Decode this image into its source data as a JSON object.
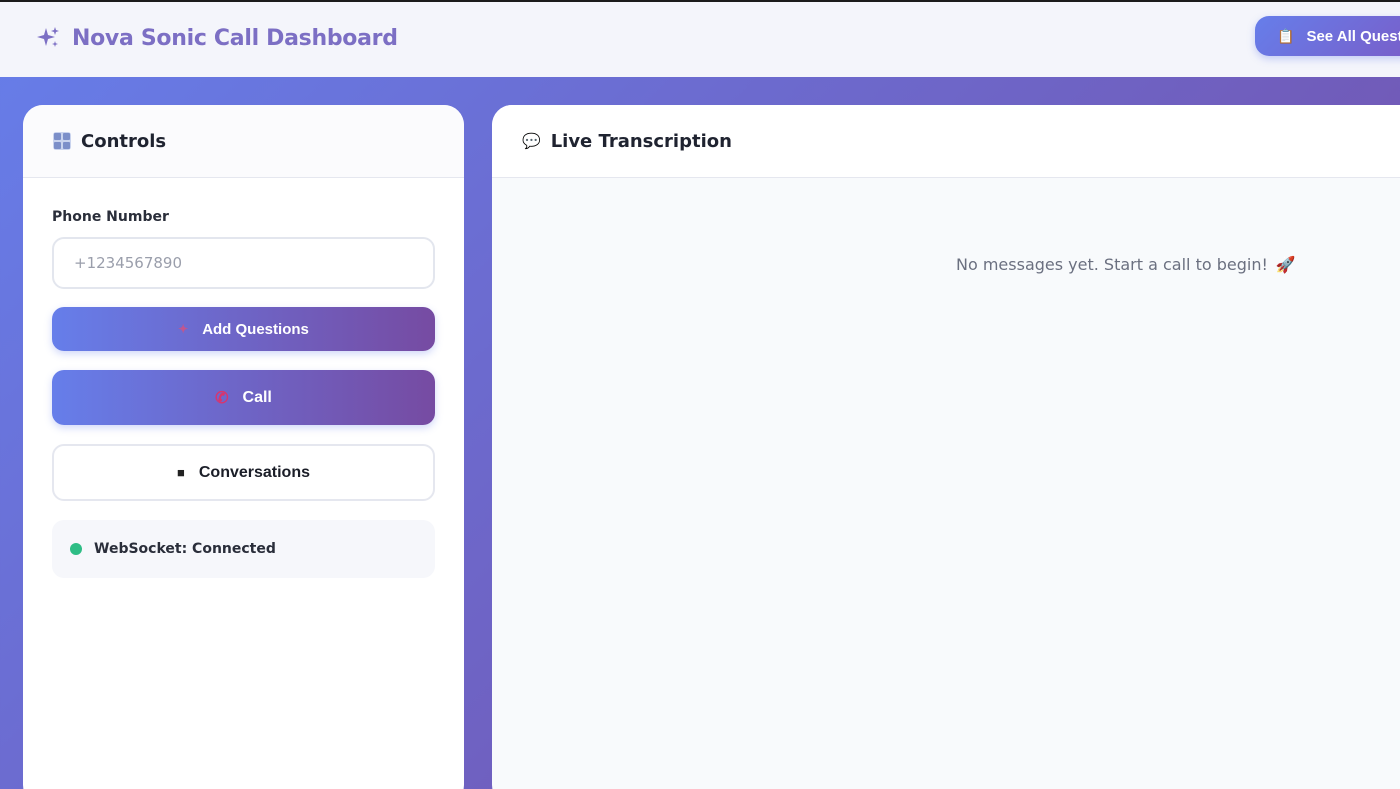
{
  "header": {
    "title": "Nova Sonic Call Dashboard",
    "brand_icon": "sparkle-icon",
    "see_all_label": "See All Questions",
    "see_all_icon": "clipboard-icon"
  },
  "controls": {
    "title": "Controls",
    "title_icon": "grid-icon",
    "phone_label": "Phone Number",
    "phone_placeholder": "+1234567890",
    "phone_value": "",
    "add_questions_label": "Add Questions",
    "add_questions_icon": "sparkle-icon",
    "call_label": "Call",
    "call_icon": "phone-icon",
    "conversations_label": "Conversations",
    "conversations_icon": "chat-icon",
    "status_text": "WebSocket: Connected",
    "status_color": "#2ebd85"
  },
  "transcription": {
    "title": "Live Transcription",
    "title_icon": "speech-bubble-icon",
    "empty_message": "No messages yet. Start a call to begin!",
    "empty_icon": "rocket-icon"
  },
  "colors": {
    "gradient_start": "#667eea",
    "gradient_end": "#764ba2",
    "brand_text": "#7c6fc4"
  }
}
